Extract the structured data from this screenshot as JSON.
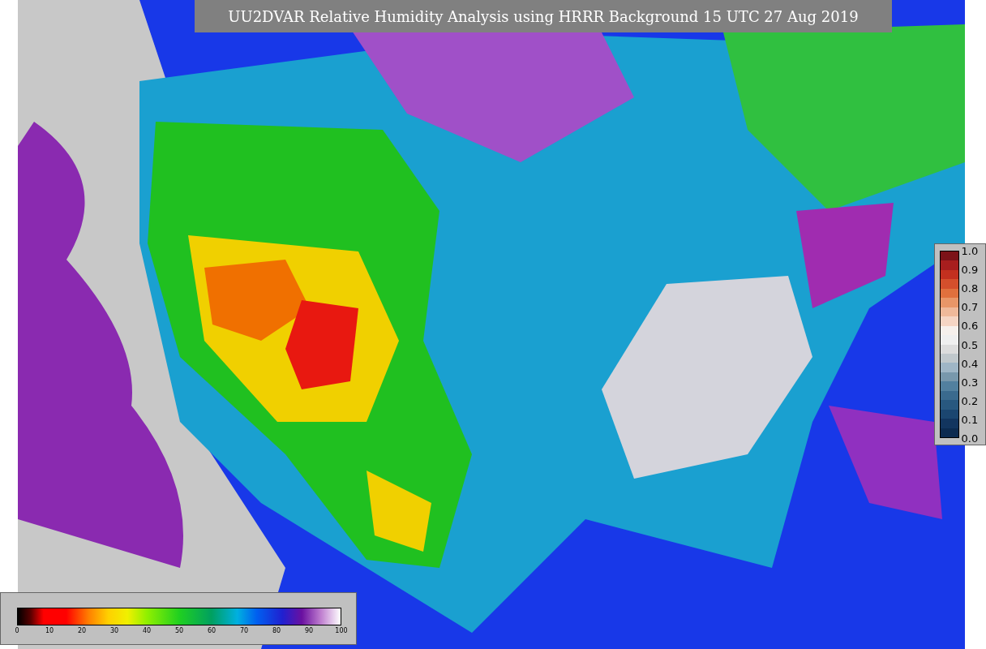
{
  "title": "UU2DVAR Relative Humidity Analysis using HRRR Background 15 UTC 27 Aug 2019",
  "humidity_colorbar": {
    "ticks": [
      "0",
      "10",
      "20",
      "30",
      "40",
      "50",
      "60",
      "70",
      "80",
      "90",
      "100"
    ]
  },
  "fraction_colorbar": {
    "ticks": [
      "1.0",
      "0.9",
      "0.8",
      "0.7",
      "0.6",
      "0.5",
      "0.4",
      "0.3",
      "0.2",
      "0.1",
      "0.0"
    ]
  }
}
